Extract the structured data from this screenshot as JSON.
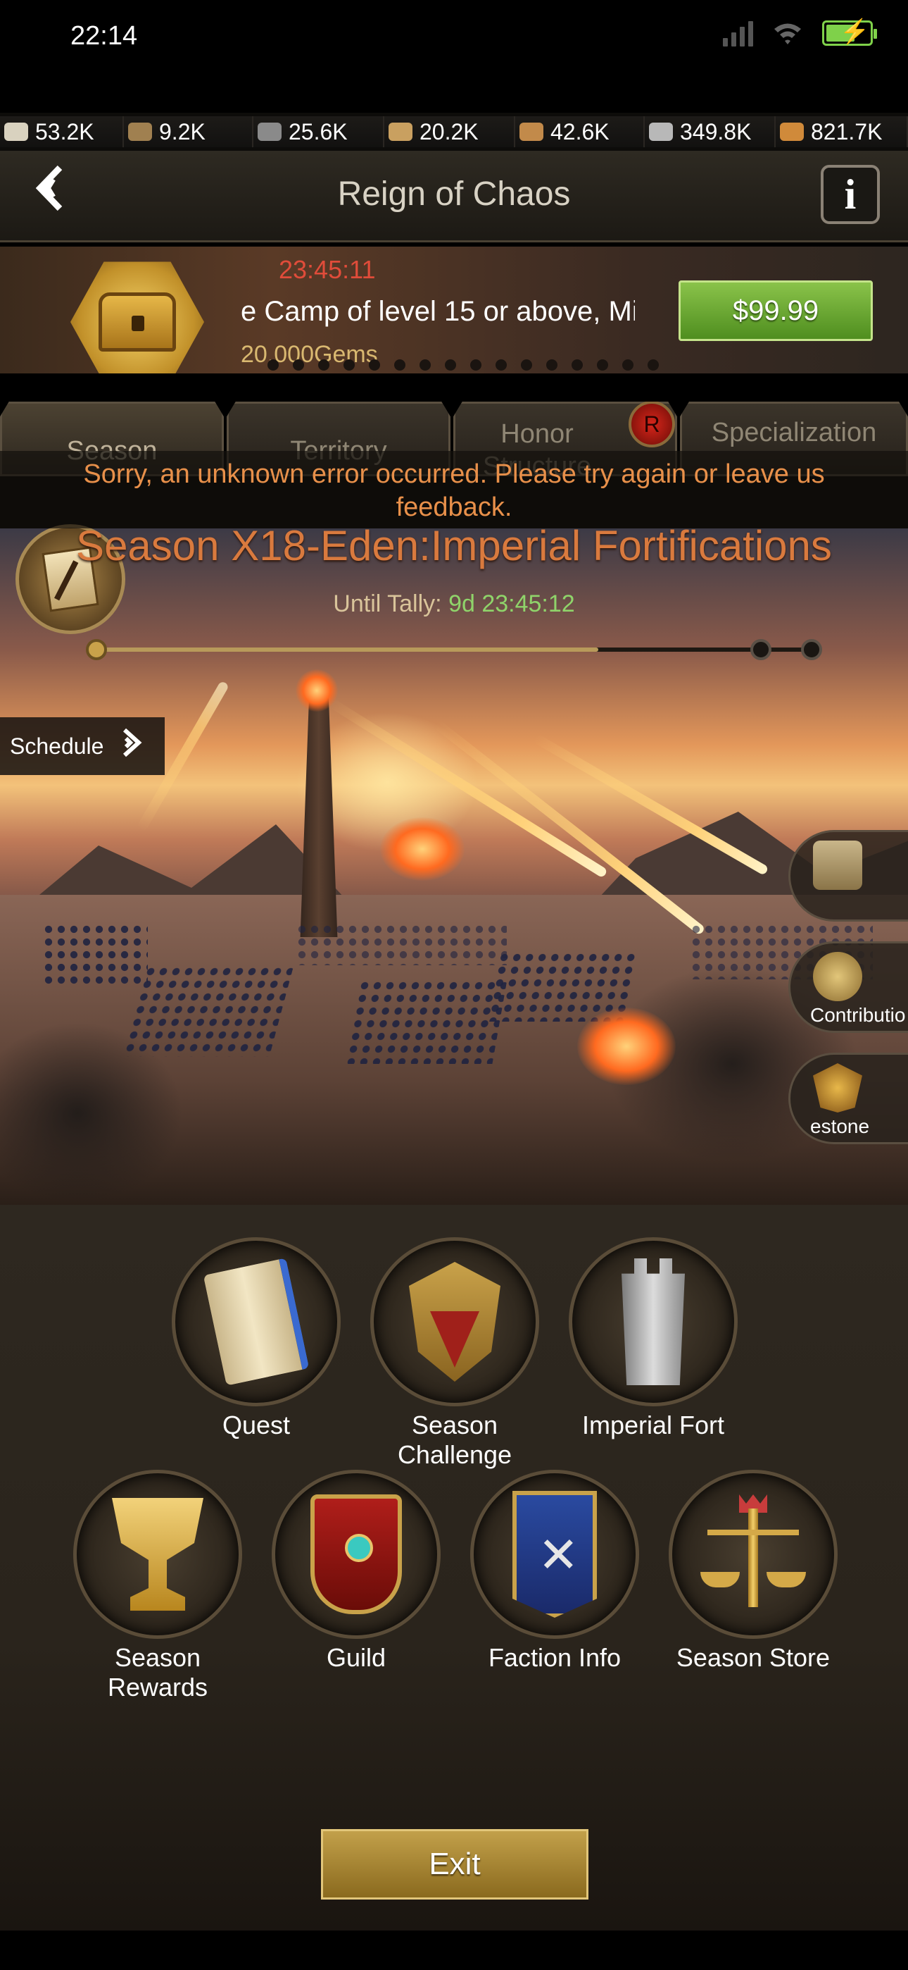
{
  "status_bar": {
    "time": "22:14"
  },
  "resources": [
    {
      "icon": "stone-ore-icon",
      "value": "53.2K",
      "color": "#d9d2bf"
    },
    {
      "icon": "wood-barrel-icon",
      "value": "9.2K",
      "color": "#a08050"
    },
    {
      "icon": "iron-icon",
      "value": "25.6K",
      "color": "#8a8a8a"
    },
    {
      "icon": "horn-icon",
      "value": "20.2K",
      "color": "#c9a060"
    },
    {
      "icon": "lumber-icon",
      "value": "42.6K",
      "color": "#c28a4a"
    },
    {
      "icon": "stone-block-icon",
      "value": "349.8K",
      "color": "#b8b8b8"
    },
    {
      "icon": "bread-icon",
      "value": "821.7K",
      "color": "#d08a3a"
    }
  ],
  "header": {
    "title": "Reign of Chaos",
    "info_label": "i"
  },
  "promo": {
    "timer": "23:45:11",
    "description": "e Camp of level 15 or above, Mi",
    "gems": "20,000Gems",
    "price": "$99.99",
    "dot_count": 16
  },
  "tabs": [
    {
      "label": "Season",
      "active": true
    },
    {
      "label": "Territory",
      "active": false
    },
    {
      "label": "Honor Structure",
      "active": false,
      "badge": "R"
    },
    {
      "label": "Specialization",
      "active": false
    }
  ],
  "toast": {
    "message": "Sorry, an unknown error occurred. Please try again or leave us feedback."
  },
  "season": {
    "title": "Season X18-Eden:Imperial Fortifications",
    "until_label": "Until Tally:",
    "until_value": "9d 23:45:12",
    "progress": 0.7
  },
  "schedule": {
    "label": "Schedule"
  },
  "side_buttons": [
    {
      "icon": "search-map-icon",
      "label": ""
    },
    {
      "icon": "laurel-icon",
      "label": "Contributio"
    },
    {
      "icon": "milestone-crest-icon",
      "label": "estone"
    }
  ],
  "menu": [
    {
      "label": "Quest",
      "icon": "scroll-icon"
    },
    {
      "label": "Season Challenge",
      "icon": "challenge-shield-icon"
    },
    {
      "label": "Imperial Fort",
      "icon": "tower-icon"
    },
    {
      "label": "Season Rewards",
      "icon": "trophy-icon"
    },
    {
      "label": "Guild",
      "icon": "guild-banner-icon"
    },
    {
      "label": "Faction Info",
      "icon": "faction-flag-icon"
    },
    {
      "label": "Season Store",
      "icon": "scale-icon"
    }
  ],
  "exit_label": "Exit",
  "colors": {
    "accent_green": "#8ac34a",
    "gold": "#c2a04a",
    "error_orange": "#e8904a",
    "timer_red": "#e04c3a"
  }
}
